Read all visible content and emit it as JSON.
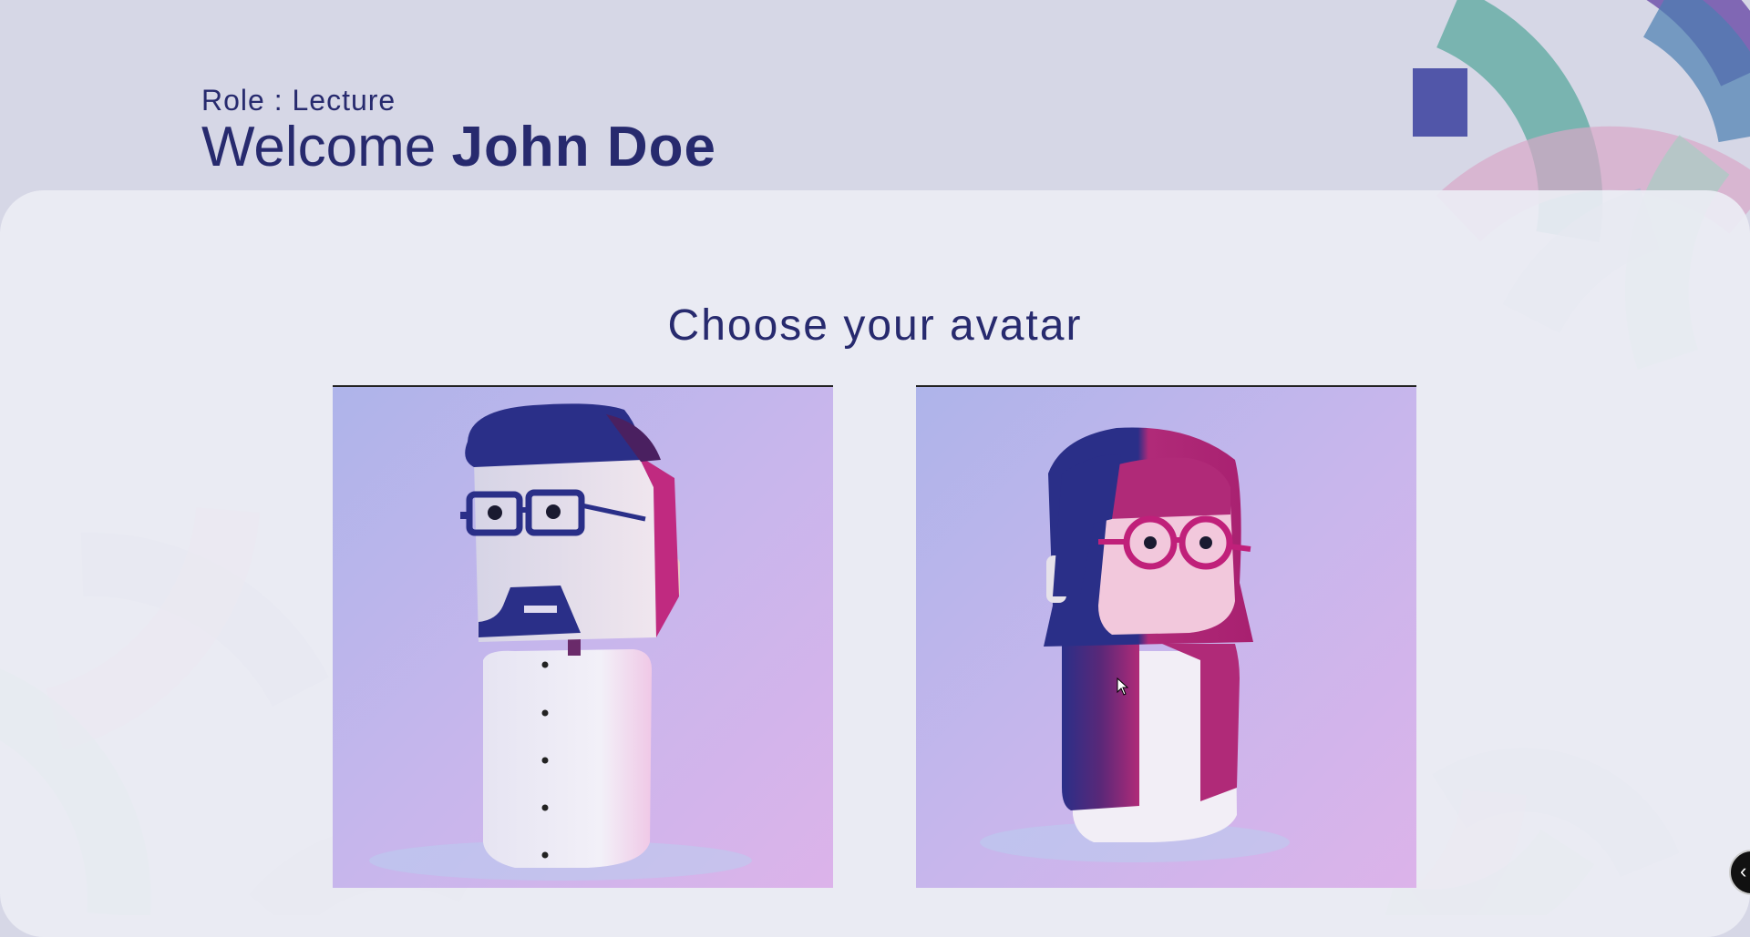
{
  "header": {
    "role_text": "Role : Lecture",
    "welcome_prefix": "Welcome",
    "user_name": "John Doe"
  },
  "main": {
    "heading": "Choose your avatar",
    "avatars": [
      {
        "name": "male-avatar"
      },
      {
        "name": "female-avatar"
      }
    ]
  },
  "colors": {
    "background": "#d6d7e6",
    "panel": "#ecedf4",
    "text": "#272a6e",
    "card_gradient_start": "#aeb4ea",
    "card_gradient_end": "#dcb3ea"
  },
  "icons": {
    "scroll_button": "chevron-left-icon"
  }
}
